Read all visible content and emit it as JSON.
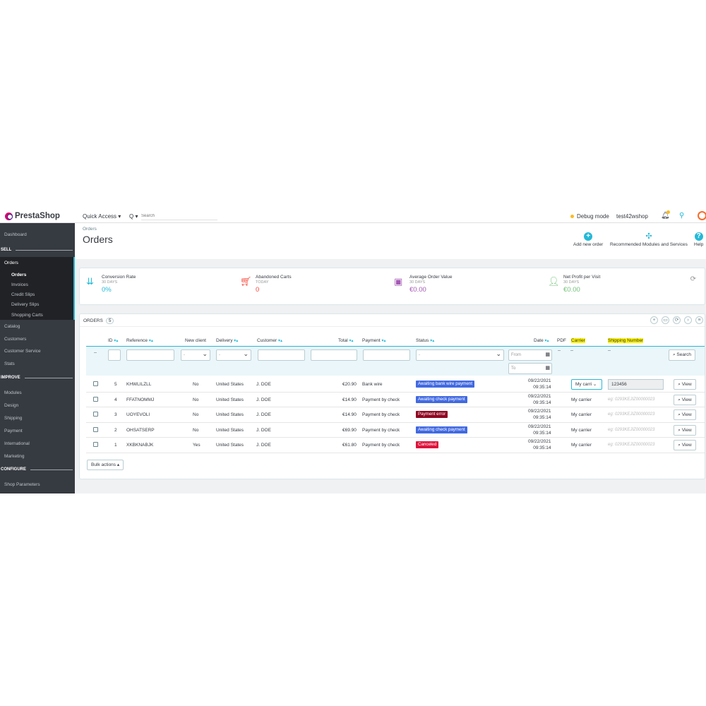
{
  "header": {
    "logo_text": "PrestaShop",
    "quick_access": "Quick Access ▾",
    "search_icon": "Q ▾",
    "search_placeholder": "Search",
    "debug_mode": "Debug mode",
    "shop_name": "test42wshop"
  },
  "sidebar": {
    "dashboard": "Dashboard",
    "sell": "SELL",
    "orders": "Orders",
    "sub": [
      "Orders",
      "Invoices",
      "Credit Slips",
      "Delivery Slips",
      "Shopping Carts"
    ],
    "catalog": "Catalog",
    "customers": "Customers",
    "customer_service": "Customer Service",
    "stats": "Stats",
    "improve": "IMPROVE",
    "modules": "Modules",
    "design": "Design",
    "shipping": "Shipping",
    "payment": "Payment",
    "international": "International",
    "marketing": "Marketing",
    "configure": "CONFIGURE",
    "shop_parameters": "Shop Parameters"
  },
  "page": {
    "breadcrumb": "Orders",
    "title": "Orders",
    "add_new_order": "Add new order",
    "recommended": "Recommended Modules and Services",
    "help": "Help"
  },
  "kpis": [
    {
      "label": "Conversion Rate",
      "sub": "30 DAYS",
      "value": "0%",
      "color": "#25b9d7",
      "icon": "sort-amount-icon"
    },
    {
      "label": "Abandoned Carts",
      "sub": "TODAY",
      "value": "0",
      "color": "#f54c3e",
      "icon": "cart-icon"
    },
    {
      "label": "Average Order Value",
      "sub": "30 DAYS",
      "value": "€0.00",
      "color": "#a45ab5",
      "icon": "money-icon"
    },
    {
      "label": "Net Profit per Visit",
      "sub": "30 DAYS",
      "value": "€0.00",
      "color": "#72c279",
      "icon": "user-icon"
    }
  ],
  "orders_panel": {
    "title": "ORDERS",
    "count": "5",
    "headers": {
      "id": "ID",
      "reference": "Reference",
      "new_client": "New client",
      "delivery": "Delivery",
      "customer": "Customer",
      "total": "Total",
      "payment": "Payment",
      "status": "Status",
      "date": "Date",
      "pdf": "PDF",
      "carrier": "Carrier",
      "shipping_number": "Shipping Number"
    },
    "filters": {
      "dash": "--",
      "select_dash": "-",
      "from": "From",
      "to": "To",
      "search": "Search"
    },
    "rows": [
      {
        "id": "5",
        "reference": "KHWLILZLL",
        "new_client": "No",
        "delivery": "United States",
        "customer": "J. DOE",
        "total": "€20.90",
        "payment": "Bank wire",
        "status": "Awaiting bank wire payment",
        "status_color": "#4169e1",
        "date": "09/22/2021",
        "time": "09:35:14",
        "carrier": "My carri",
        "shipping": "123456",
        "editing": true,
        "view": "View"
      },
      {
        "id": "4",
        "reference": "FFATNOMMJ",
        "new_client": "No",
        "delivery": "United States",
        "customer": "J. DOE",
        "total": "€14.90",
        "payment": "Payment by check",
        "status": "Awaiting check payment",
        "status_color": "#4169e1",
        "date": "09/22/2021",
        "time": "09:35:14",
        "carrier": "My carrier",
        "shipping": "eg: 0293KEJIZ00000023",
        "editing": false,
        "view": "View"
      },
      {
        "id": "3",
        "reference": "UOYEVOLI",
        "new_client": "No",
        "delivery": "United States",
        "customer": "J. DOE",
        "total": "€14.90",
        "payment": "Payment by check",
        "status": "Payment error",
        "status_color": "#8f0621",
        "date": "09/22/2021",
        "time": "09:35:14",
        "carrier": "My carrier",
        "shipping": "eg: 0293KEJIZ00000023",
        "editing": false,
        "view": "View"
      },
      {
        "id": "2",
        "reference": "OHSATSERP",
        "new_client": "No",
        "delivery": "United States",
        "customer": "J. DOE",
        "total": "€69.90",
        "payment": "Payment by check",
        "status": "Awaiting check payment",
        "status_color": "#4169e1",
        "date": "09/22/2021",
        "time": "09:35:14",
        "carrier": "My carrier",
        "shipping": "eg: 0293KEJIZ00000023",
        "editing": false,
        "view": "View"
      },
      {
        "id": "1",
        "reference": "XKBKNABJK",
        "new_client": "Yes",
        "delivery": "United States",
        "customer": "J. DOE",
        "total": "€61.80",
        "payment": "Payment by check",
        "status": "Canceled",
        "status_color": "#dc143c",
        "date": "09/22/2021",
        "time": "09:35:14",
        "carrier": "My carrier",
        "shipping": "eg: 0293KEJIZ00000023",
        "editing": false,
        "view": "View"
      }
    ],
    "bulk_actions": "Bulk actions ▴"
  }
}
